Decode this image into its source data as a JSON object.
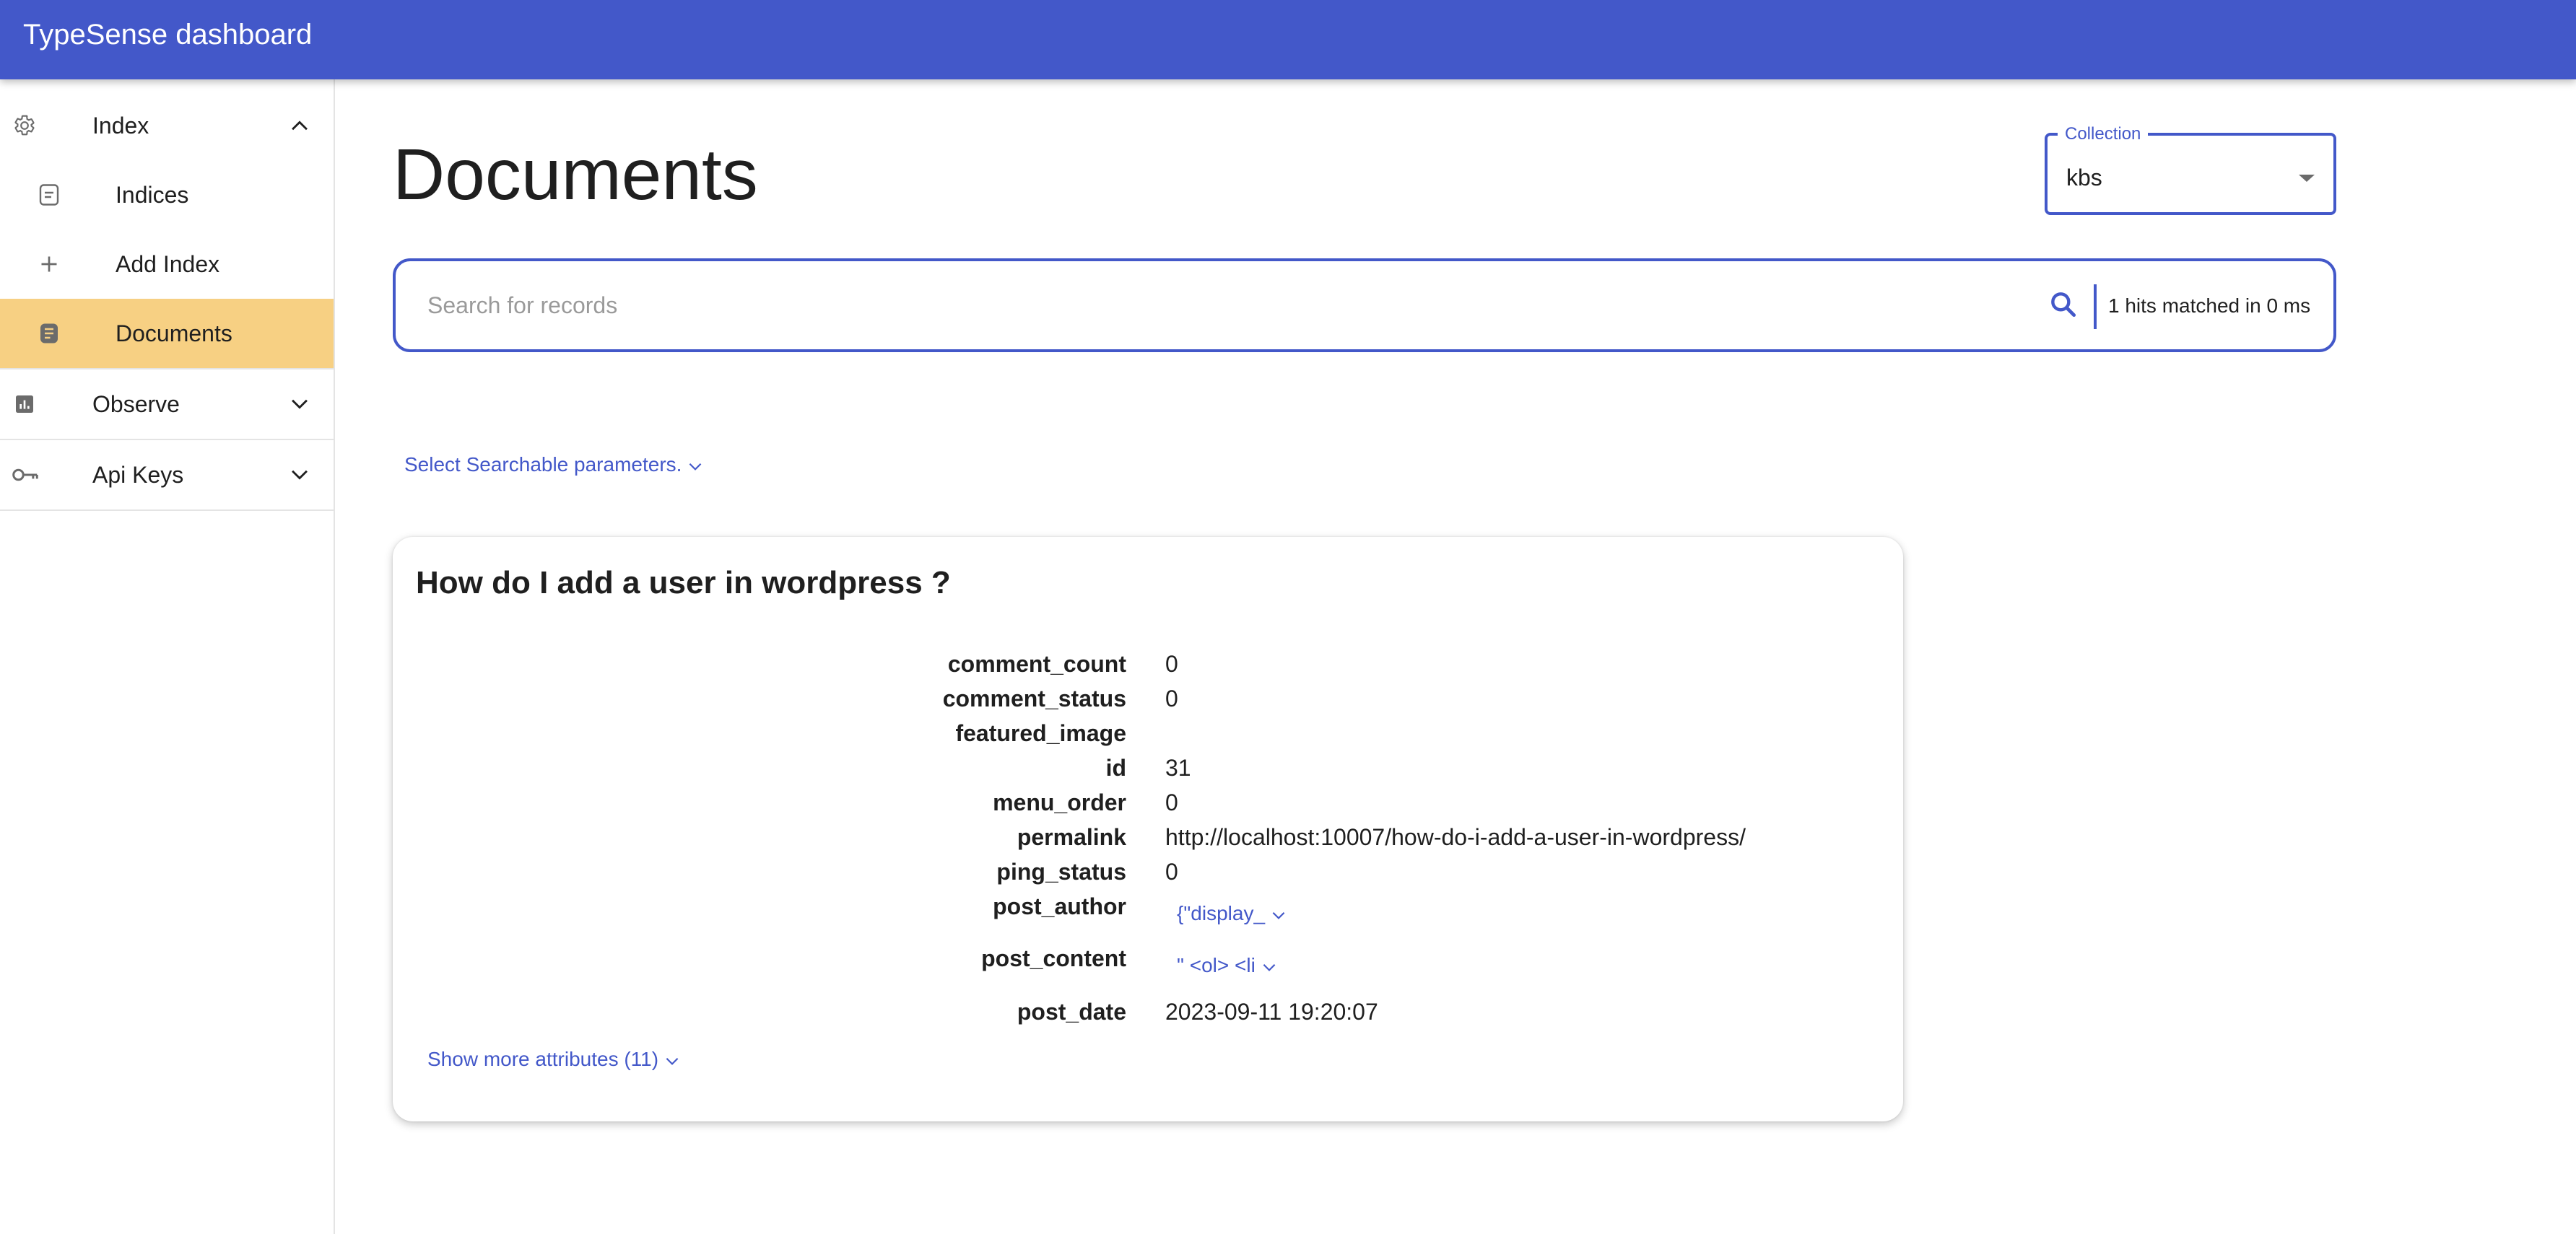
{
  "app": {
    "title": "TypeSense dashboard"
  },
  "sidebar": {
    "index_group": {
      "label": "Index",
      "icon": "gear-icon",
      "expanded": true
    },
    "items": [
      {
        "label": "Indices",
        "icon": "document-outline-icon",
        "selected": false
      },
      {
        "label": "Add Index",
        "icon": "plus-icon",
        "selected": false
      },
      {
        "label": "Documents",
        "icon": "document-filled-icon",
        "selected": true
      }
    ],
    "observe_group": {
      "label": "Observe",
      "icon": "bar-chart-icon",
      "expanded": false
    },
    "apikeys_group": {
      "label": "Api Keys",
      "icon": "key-icon",
      "expanded": false
    },
    "selected_color": "#f7d083"
  },
  "main": {
    "page_title": "Documents",
    "collection": {
      "label": "Collection",
      "value": "kbs"
    },
    "search": {
      "placeholder": "Search for records",
      "stats": "1 hits matched in 0 ms"
    },
    "params_link": "Select Searchable parameters."
  },
  "result": {
    "title": "How do I add a user in wordpress ?",
    "attributes": [
      {
        "key": "comment_count",
        "value": "0"
      },
      {
        "key": "comment_status",
        "value": "0"
      },
      {
        "key": "featured_image",
        "value": ""
      },
      {
        "key": "id",
        "value": "31"
      },
      {
        "key": "menu_order",
        "value": "0"
      },
      {
        "key": "permalink",
        "value": "http://localhost:10007/how-do-i-add-a-user-in-wordpress/"
      },
      {
        "key": "ping_status",
        "value": "0"
      },
      {
        "key": "post_author",
        "value": "{\"display_"
      },
      {
        "key": "post_content",
        "value": "\" <ol> <li"
      },
      {
        "key": "post_date",
        "value": "2023-09-11 19:20:07"
      }
    ],
    "show_more": "Show more attributes (11)"
  },
  "colors": {
    "primary": "#4358c9",
    "selected": "#f7d083",
    "text": "#1f1f1f"
  }
}
